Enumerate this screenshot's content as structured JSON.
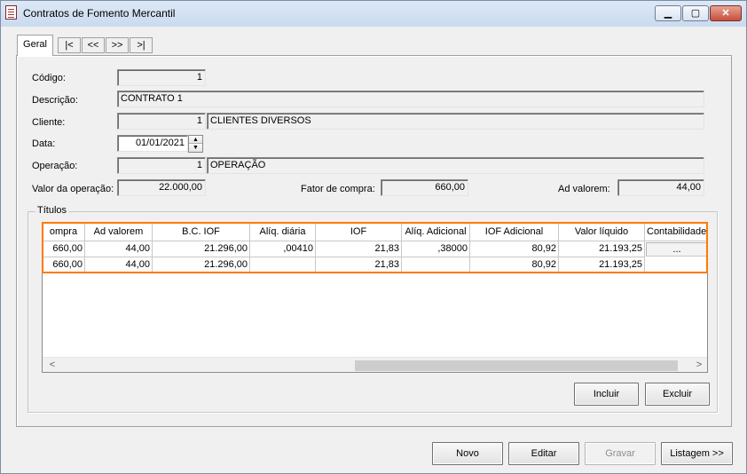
{
  "window": {
    "title": "Contratos de Fomento Mercantil",
    "min_glyph": "▁",
    "max_glyph": "▢",
    "close_glyph": "✕"
  },
  "tabs": {
    "active": "Geral",
    "nav": [
      "|<",
      "<<",
      ">>",
      ">|"
    ]
  },
  "form": {
    "codigo_label": "Código:",
    "codigo_value": "1",
    "descricao_label": "Descrição:",
    "descricao_value": "CONTRATO 1",
    "cliente_label": "Cliente:",
    "cliente_code": "1",
    "cliente_name": "CLIENTES DIVERSOS",
    "data_label": "Data:",
    "data_value": "01/01/2021",
    "operacao_label": "Operação:",
    "operacao_code": "1",
    "operacao_name": "OPERAÇÃO",
    "valor_label": "Valor da operação:",
    "valor_value": "22.000,00",
    "fator_label": "Fator de compra:",
    "fator_value": "660,00",
    "ad_valorem_label": "Ad valorem:",
    "ad_valorem_value": "44,00"
  },
  "titulos": {
    "group_label": "Títulos",
    "columns": [
      "ompra",
      "Ad valorem",
      "B.C. IOF",
      "Alíq. diária",
      "IOF",
      "Alíq. Adicional",
      "IOF Adicional",
      "Valor líquido",
      "Contabilidade"
    ],
    "rows": [
      [
        "660,00",
        "44,00",
        "21.296,00",
        ",00410",
        "21,83",
        ",38000",
        "80,92",
        "21.193,25",
        "..."
      ],
      [
        "660,00",
        "44,00",
        "21.296,00",
        "",
        "21,83",
        "",
        "80,92",
        "21.193,25",
        ""
      ]
    ],
    "incluir_label": "Incluir",
    "excluir_label": "Excluir",
    "scroll_left": "<",
    "scroll_right": ">"
  },
  "footer": {
    "novo_label": "Novo",
    "editar_label": "Editar",
    "gravar_label": "Gravar",
    "listagem_label": "Listagem >>"
  },
  "colors": {
    "highlight": "#ff7a00",
    "titlebar": "#c9dbef"
  }
}
